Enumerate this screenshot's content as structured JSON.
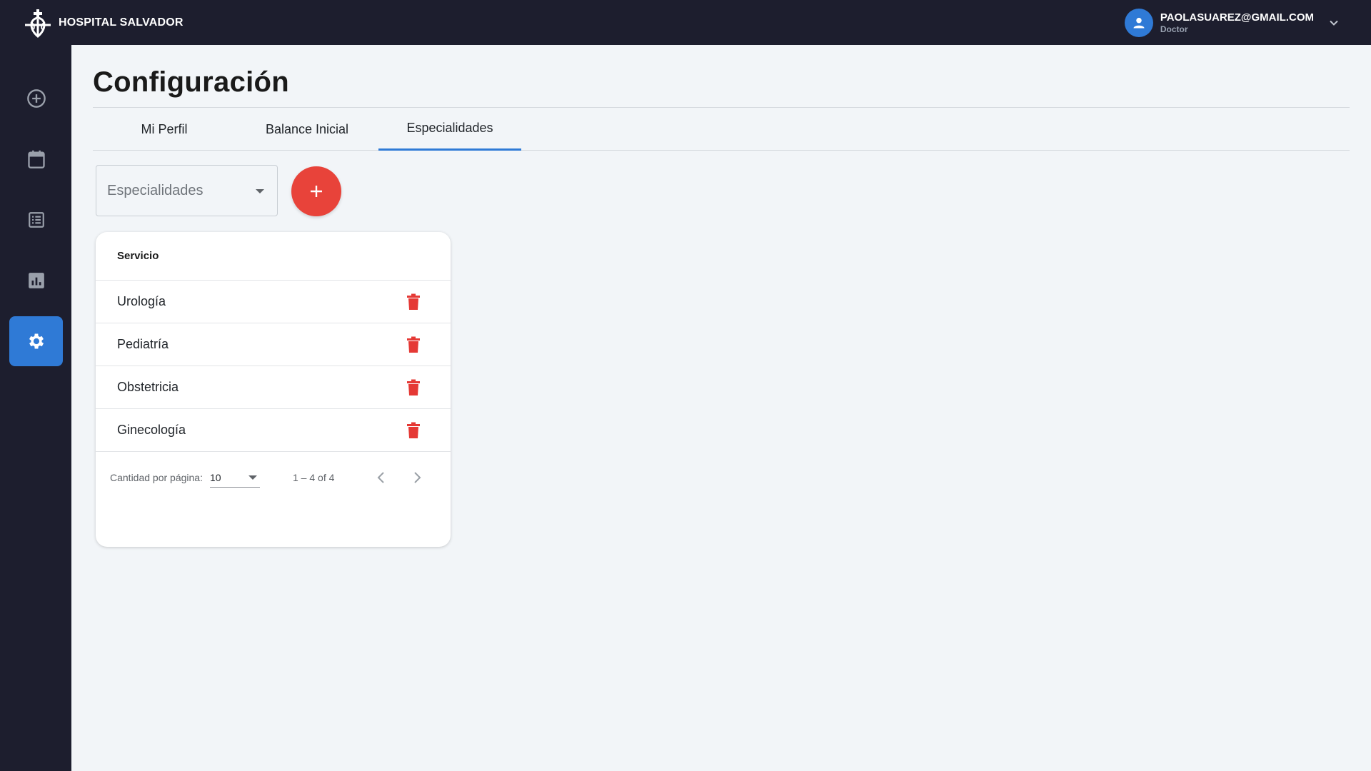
{
  "brand": {
    "name": "HOSPITAL SALVADOR",
    "logo_icon": "hospital-cross-logo"
  },
  "user": {
    "email": "PAOLASUAREZ@GMAIL.COM",
    "role": "Doctor"
  },
  "sidebar": {
    "items": [
      {
        "name": "add",
        "icon": "add-circle-icon",
        "active": false
      },
      {
        "name": "calendar",
        "icon": "calendar-icon",
        "active": false
      },
      {
        "name": "list",
        "icon": "list-icon",
        "active": false
      },
      {
        "name": "reports",
        "icon": "chart-icon",
        "active": false
      },
      {
        "name": "settings",
        "icon": "gear-icon",
        "active": true
      }
    ]
  },
  "page": {
    "title": "Configuración"
  },
  "tabs": [
    {
      "label": "Mi Perfil",
      "active": false
    },
    {
      "label": "Balance Inicial",
      "active": false
    },
    {
      "label": "Especialidades",
      "active": true
    }
  ],
  "specialty_select": {
    "placeholder": "Especialidades"
  },
  "table": {
    "header": "Servicio",
    "rows": [
      {
        "name": "Urología"
      },
      {
        "name": "Pediatría"
      },
      {
        "name": "Obstetricia"
      },
      {
        "name": "Ginecología"
      }
    ]
  },
  "paginator": {
    "per_page_label": "Cantidad por página:",
    "per_page_value": "10",
    "range_label": "1 – 4 of 4"
  },
  "colors": {
    "topbar": "#1d1e2e",
    "accent": "#2f7ad6",
    "fab": "#e8433a",
    "delete": "#e53935",
    "background": "#f2f5f8"
  }
}
